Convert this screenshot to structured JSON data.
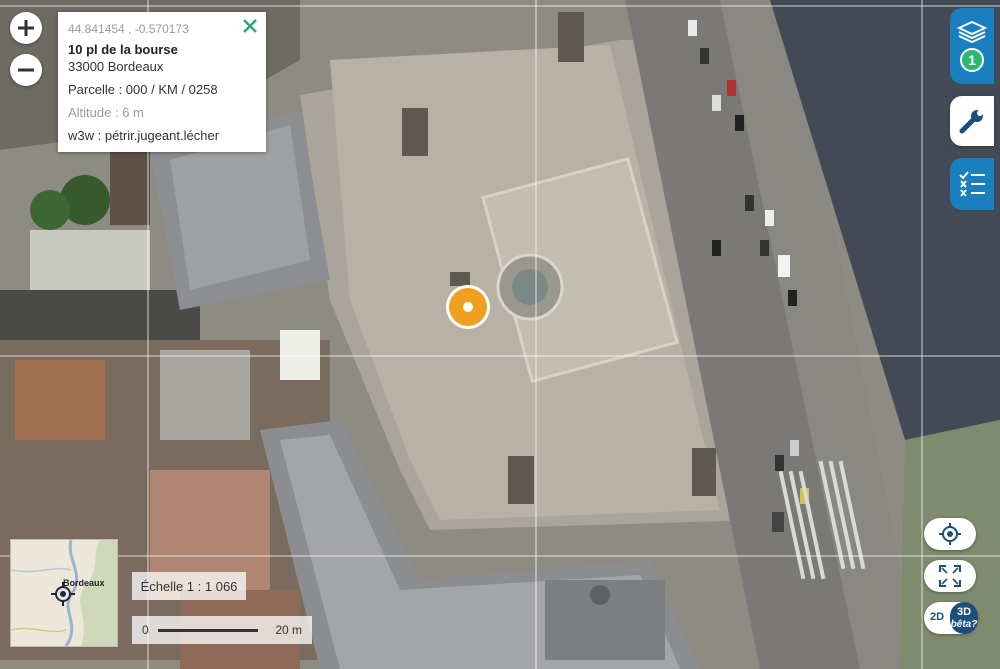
{
  "map": {
    "popup": {
      "coordinates": "44.841454 , -0.570173",
      "address_line1": "10 pl de la bourse",
      "address_line2": "33000 Bordeaux",
      "parcel": "Parcelle : 000 / KM / 0258",
      "altitude": "Altitude : 6 m",
      "w3w": "w3w : pétrir.jugeant.lécher"
    },
    "layers_badge": "1",
    "overview_label": "Bordeaux",
    "scale_text": "Échelle 1 : 1 066",
    "scale_bar": {
      "start": "0",
      "end": "20 m"
    },
    "view_toggle": {
      "option_2d": "2D",
      "option_3d": "3D",
      "beta": "bêta",
      "help": "?"
    },
    "colors": {
      "accent_blue": "#1a7fbf",
      "toggle_dark": "#1a4f79",
      "badge_green": "#2bb673",
      "close_green": "#2aa876",
      "marker_orange": "#f0a020"
    }
  }
}
